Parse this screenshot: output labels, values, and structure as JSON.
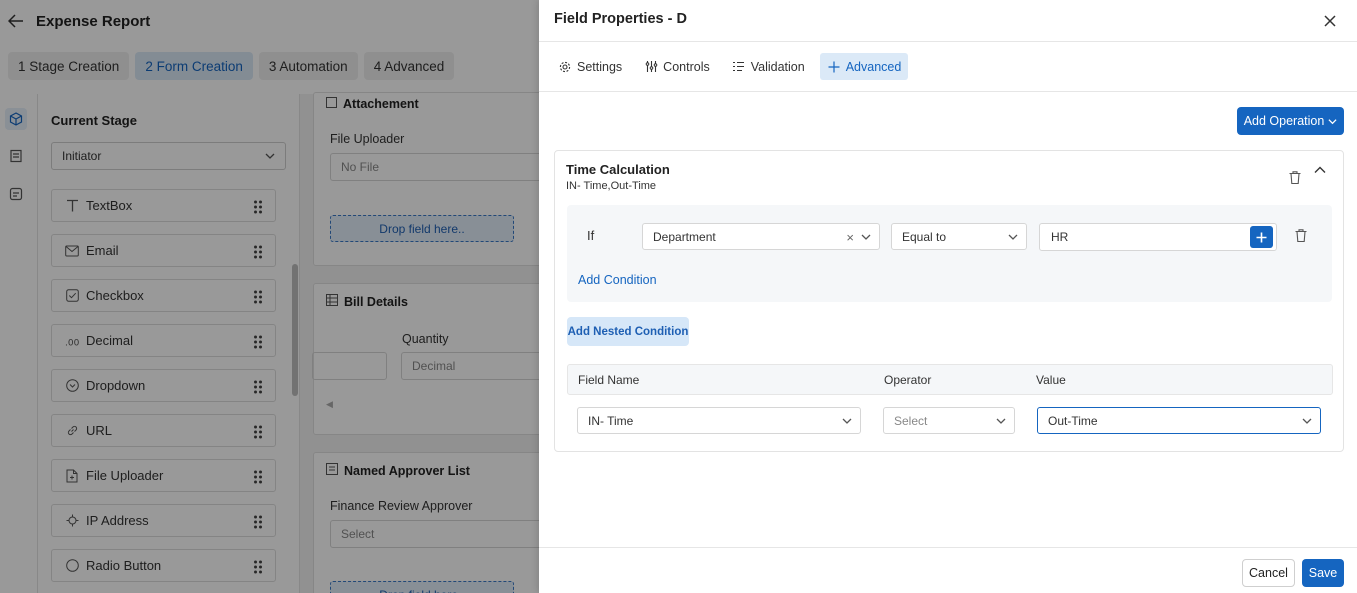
{
  "app": {
    "title": "Expense Report",
    "stages": [
      {
        "label": "1  Stage Creation"
      },
      {
        "label": "2  Form Creation"
      },
      {
        "label": "3  Automation"
      },
      {
        "label": "4  Advanced"
      }
    ],
    "active_stage_index": 1
  },
  "palette": {
    "current_stage_label": "Current Stage",
    "current_stage_value": "Initiator",
    "items": [
      {
        "label": "TextBox",
        "icon": "text-icon"
      },
      {
        "label": "Email",
        "icon": "mail-icon"
      },
      {
        "label": "Checkbox",
        "icon": "checkbox-icon"
      },
      {
        "label": "Decimal",
        "icon": "decimal-icon"
      },
      {
        "label": "Dropdown",
        "icon": "dropdown-icon"
      },
      {
        "label": "URL",
        "icon": "link-icon"
      },
      {
        "label": "File Uploader",
        "icon": "file-icon"
      },
      {
        "label": "IP Address",
        "icon": "ip-icon"
      },
      {
        "label": "Radio Button",
        "icon": "radio-icon"
      }
    ]
  },
  "canvas": {
    "attachment": {
      "title": "Attachement",
      "field_label": "File Uploader",
      "field_value": "No File",
      "drop_text": "Drop field here.."
    },
    "bill_details": {
      "title": "Bill Details",
      "quantity_label": "Quantity",
      "quantity_placeholder": "Decimal"
    },
    "approver": {
      "title": "Named Approver List",
      "field_label": "Finance Review Approver",
      "field_placeholder": "Select",
      "drop_text": "Drop field here.."
    }
  },
  "drawer": {
    "title": "Field Properties - D",
    "tabs": [
      {
        "label": "Settings",
        "icon": "gear-icon"
      },
      {
        "label": "Controls",
        "icon": "sliders-icon"
      },
      {
        "label": "Validation",
        "icon": "list-check-icon"
      },
      {
        "label": "Advanced",
        "icon": "plus-icon"
      }
    ],
    "active_tab_index": 3,
    "add_operation_label": "Add Operation",
    "rule": {
      "title": "Time Calculation",
      "subtitle": "IN- Time,Out-Time",
      "if_label": "If",
      "condition_field": "Department",
      "condition_operator": "Equal to",
      "condition_value": "HR",
      "add_condition_label": "Add Condition",
      "add_nested_label": "Add Nested Condition",
      "columns": [
        "Field Name",
        "Operator",
        "Value"
      ],
      "row": {
        "field_name": "IN- Time",
        "operator_placeholder": "Select",
        "value": "Out-Time"
      }
    },
    "cancel_label": "Cancel",
    "save_label": "Save",
    "colors": {
      "accent": "#1565c0",
      "accent_light": "#dbe9f7"
    }
  }
}
